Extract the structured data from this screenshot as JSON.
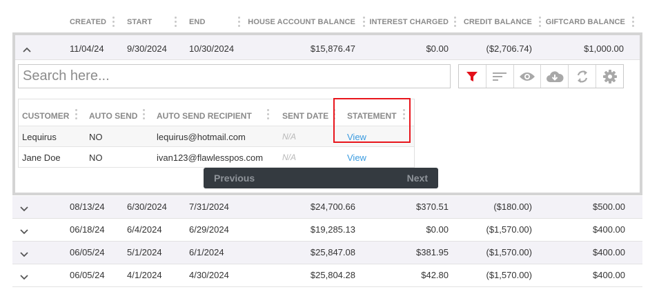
{
  "columns": [
    "CREATED",
    "START",
    "END",
    "HOUSE ACCOUNT BALANCE",
    "INTEREST CHARGED",
    "CREDIT BALANCE",
    "GIFTCARD BALANCE"
  ],
  "expanded_row": {
    "created": "11/04/24",
    "start": "9/30/2024",
    "end": "10/30/2024",
    "house": "$15,876.47",
    "interest": "$0.00",
    "credit": "($2,706.74)",
    "giftcard": "$1,000.00"
  },
  "search": {
    "placeholder": "Search here..."
  },
  "toolbar_icons": [
    "filter-icon",
    "sort-icon",
    "eye-icon",
    "cloud-download-icon",
    "refresh-icon",
    "gear-icon"
  ],
  "colors": {
    "filter_active": "#e3101a",
    "icon_inactive": "#a8a8a8",
    "link": "#3a9be0",
    "highlight": "#e8141b"
  },
  "inner_table": {
    "columns": [
      "CUSTOMER",
      "AUTO SEND",
      "AUTO SEND RECIPIENT",
      "SENT DATE",
      "STATEMENT"
    ],
    "rows": [
      {
        "customer": "Lequirus",
        "auto_send": "NO",
        "recipient": "lequirus@hotmail.com",
        "sent_date": "N/A",
        "statement": "View"
      },
      {
        "customer": "Jane Doe",
        "auto_send": "NO",
        "recipient": "ivan123@flawlesspos.com",
        "sent_date": "N/A",
        "statement": "View"
      }
    ]
  },
  "pager": {
    "previous": "Previous",
    "next": "Next"
  },
  "rows": [
    {
      "created": "08/13/24",
      "start": "6/30/2024",
      "end": "7/31/2024",
      "house": "$24,700.66",
      "interest": "$370.51",
      "credit": "($180.00)",
      "giftcard": "$500.00"
    },
    {
      "created": "06/18/24",
      "start": "6/4/2024",
      "end": "6/29/2024",
      "house": "$19,285.13",
      "interest": "$0.00",
      "credit": "($1,570.00)",
      "giftcard": "$400.00"
    },
    {
      "created": "06/05/24",
      "start": "5/1/2024",
      "end": "6/1/2024",
      "house": "$25,847.08",
      "interest": "$381.95",
      "credit": "($1,570.00)",
      "giftcard": "$400.00"
    },
    {
      "created": "06/05/24",
      "start": "4/1/2024",
      "end": "4/30/2024",
      "house": "$25,804.28",
      "interest": "$42.80",
      "credit": "($1,570.00)",
      "giftcard": "$400.00"
    }
  ]
}
